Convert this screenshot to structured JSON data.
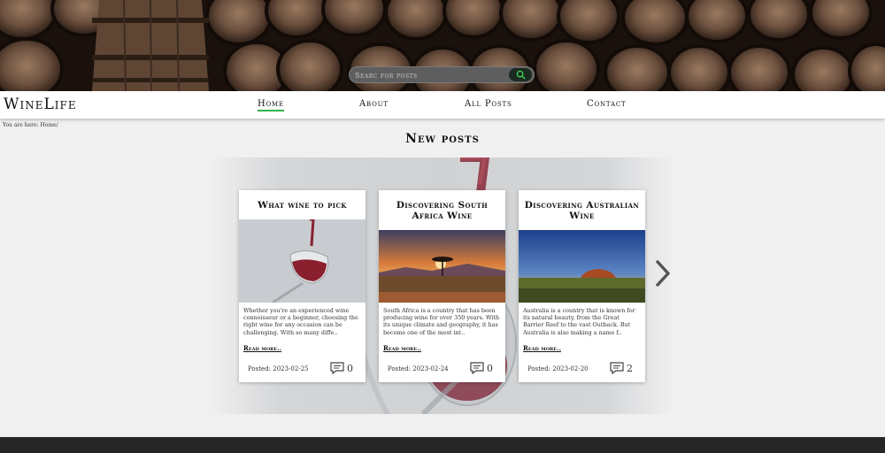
{
  "search": {
    "placeholder": "Searc for posts",
    "button_icon": "search-icon"
  },
  "site": {
    "logo": "WineLife"
  },
  "nav": {
    "items": [
      {
        "label": "Home",
        "active": true
      },
      {
        "label": "About",
        "active": false
      },
      {
        "label": "All Posts",
        "active": false
      },
      {
        "label": "Contact",
        "active": false
      }
    ]
  },
  "breadcrumb": "You are here: Home/",
  "section": {
    "title": "New posts"
  },
  "posts": [
    {
      "title": "What wine to pick",
      "excerpt": "Whether you're an experienced wine connoisseur or a beginner, choosing the right wine for any occasion can be challenging. With so many diffe..",
      "read_more": "Read more..",
      "posted": "Posted: 2023-02-25",
      "comments": "0"
    },
    {
      "title": "Discovering South Africa Wine",
      "excerpt": "South Africa is a country that has been producing wine for over 350 years. With its unique climate and geography, it has become one of the most int..",
      "read_more": "Read more..",
      "posted": "Posted: 2023-02-24",
      "comments": "0"
    },
    {
      "title": "Discovering Australian Wine",
      "excerpt": "Australia is a country that is known for its natural beauty, from the Great Barrier Reef to the vast Outback. But Australia is also making a name f..",
      "read_more": "Read more..",
      "posted": "Posted: 2023-02-20",
      "comments": "2"
    }
  ],
  "colors": {
    "accent": "#2fb34a",
    "footer": "#262626",
    "search_bg": "#5e5e5e"
  }
}
